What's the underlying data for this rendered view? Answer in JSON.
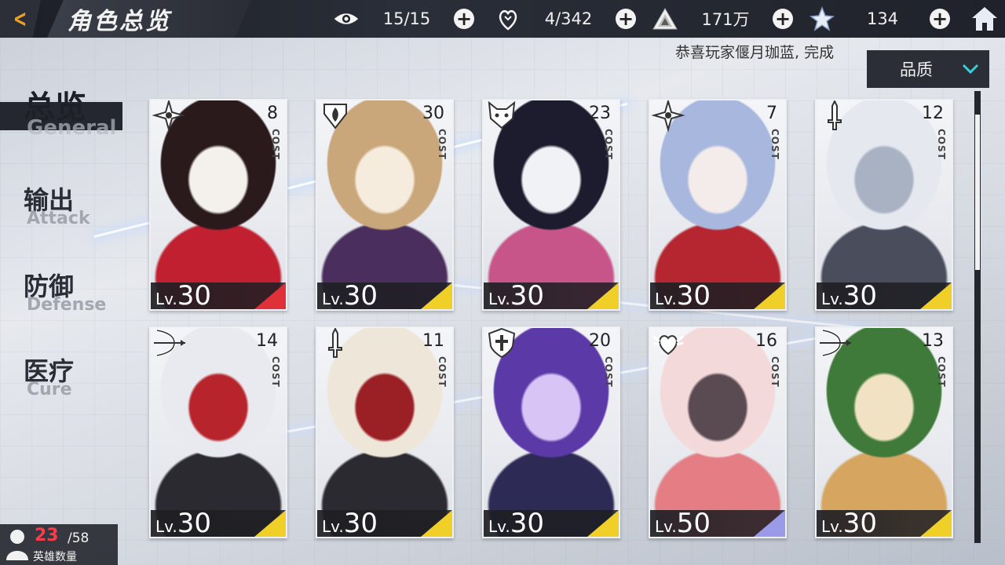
{
  "header": {
    "back_icon": "back-arrow-icon",
    "title": "角色总览",
    "resources": [
      {
        "icon": "eye-icon",
        "value": "15/15"
      },
      {
        "icon": "heart-hand-icon",
        "value": "4/342"
      },
      {
        "icon": "pyramid-coin-icon",
        "value": "171万"
      },
      {
        "icon": "star-crystal-icon",
        "value": "134"
      }
    ],
    "home_icon": "home-icon"
  },
  "announcement": "恭喜玩家偃月珈蓝, 完成",
  "quality_filter": {
    "label": "品质"
  },
  "nav": {
    "items": [
      {
        "zh": "总览",
        "en": "General",
        "active": true
      },
      {
        "zh": "输出",
        "en": "Attack",
        "active": false
      },
      {
        "zh": "防御",
        "en": "Defense",
        "active": false
      },
      {
        "zh": "医疗",
        "en": "Cure",
        "active": false
      }
    ]
  },
  "cost_label": "COST",
  "level_prefix": "Lv.",
  "cards": [
    {
      "cost": "8",
      "level": "30",
      "class_icon": "shuriken-icon",
      "corner": "#e0303a",
      "palette": [
        "#2a1a1c",
        "#c02030",
        "#f4f0ec"
      ]
    },
    {
      "cost": "30",
      "level": "30",
      "class_icon": "flame-icon",
      "corner": "#f0d028",
      "palette": [
        "#c9a77a",
        "#4a2f5e",
        "#f5ecde"
      ]
    },
    {
      "cost": "23",
      "level": "30",
      "class_icon": "fox-mask-icon",
      "corner": "#f0d028",
      "palette": [
        "#1d1c2e",
        "#c8558a",
        "#f1f2f6"
      ]
    },
    {
      "cost": "7",
      "level": "30",
      "class_icon": "shuriken-icon",
      "corner": "#f0d028",
      "palette": [
        "#a7b7de",
        "#b52630",
        "#f3ecea"
      ]
    },
    {
      "cost": "12",
      "level": "30",
      "class_icon": "sword-icon",
      "corner": "#f0d028",
      "palette": [
        "#e5e8ef",
        "#4a4e5c",
        "#a9b2c3"
      ]
    },
    {
      "cost": "14",
      "level": "30",
      "class_icon": "bow-icon",
      "corner": "#f0d028",
      "palette": [
        "#e8eaf0",
        "#2a2a30",
        "#b8242c"
      ]
    },
    {
      "cost": "11",
      "level": "30",
      "class_icon": "sword-icon",
      "corner": "#f0d028",
      "palette": [
        "#efe6da",
        "#2b2a30",
        "#9b2026"
      ]
    },
    {
      "cost": "20",
      "level": "30",
      "class_icon": "shield-icon",
      "corner": "#f0d028",
      "palette": [
        "#5b3aa8",
        "#2d2a55",
        "#d8c5f5"
      ]
    },
    {
      "cost": "16",
      "level": "50",
      "class_icon": "heart-wing-icon",
      "corner": "#9a9ae8",
      "palette": [
        "#f4d9da",
        "#e57e84",
        "#5a4a52"
      ]
    },
    {
      "cost": "13",
      "level": "30",
      "class_icon": "bow-icon",
      "corner": "#f0d028",
      "palette": [
        "#3f7a3a",
        "#d6a660",
        "#f0e2c2"
      ]
    }
  ],
  "hero_count": {
    "current": "23",
    "max": "/58",
    "label": "英雄数量"
  }
}
